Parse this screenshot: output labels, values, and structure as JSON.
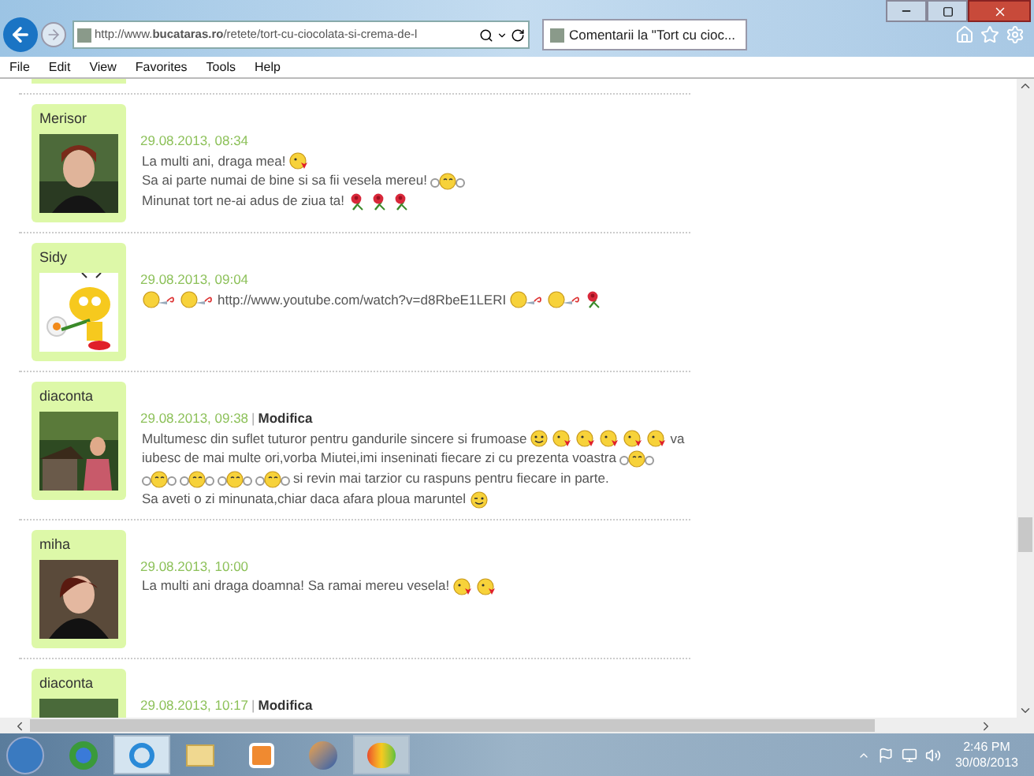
{
  "browser": {
    "address": "http://www.**bucataras.ro**/retete/tort-cu-ciocolata-si-crema-de-l",
    "tabs": [
      {
        "title": "Comentarii la \"Tort cu cioc...",
        "selected": true
      }
    ]
  },
  "menu": [
    "File",
    "Edit",
    "View",
    "Favorites",
    "Tools",
    "Help"
  ],
  "comments": [
    {
      "author": "Merisor",
      "date": "29.08.2013, 08:34",
      "lines": [
        [
          {
            "kind": "text",
            "text": "La multi ani, draga mea!"
          },
          {
            "kind": "kiss"
          }
        ],
        [
          {
            "kind": "text",
            "text": "Sa ai parte numai de bine si sa fii vesela mereu!"
          },
          {
            "kind": "hug"
          }
        ],
        [
          {
            "kind": "text",
            "text": "Minunat tort ne-ai adus de ziua ta!"
          },
          {
            "kind": "rose"
          },
          {
            "kind": "rose"
          },
          {
            "kind": "rose"
          }
        ]
      ]
    },
    {
      "author": "Sidy",
      "date": "29.08.2013, 09:04",
      "lines": [
        [
          {
            "kind": "party"
          },
          {
            "kind": "party"
          },
          {
            "kind": "text",
            "text": "http://www.youtube.com/watch?v=d8RbeE1LERI"
          },
          {
            "kind": "party"
          },
          {
            "kind": "party"
          },
          {
            "kind": "rose"
          }
        ]
      ]
    },
    {
      "author": "diaconta",
      "date": "29.08.2013, 09:38",
      "edit": {
        "separator": "|",
        "label": "Modifica"
      },
      "lines": [
        [
          {
            "kind": "text",
            "text": "Multumesc din suflet tuturor pentru gandurile sincere si frumoase"
          },
          {
            "kind": "smile"
          },
          {
            "kind": "kiss"
          },
          {
            "kind": "kiss"
          },
          {
            "kind": "kiss"
          },
          {
            "kind": "kiss"
          },
          {
            "kind": "kiss"
          },
          {
            "kind": "text",
            "text": "va"
          }
        ],
        [
          {
            "kind": "text",
            "text": "iubesc de mai multe ori,vorba Miutei,imi inseninati fiecare zi cu prezenta voastra"
          },
          {
            "kind": "hug"
          }
        ],
        [
          {
            "kind": "hug"
          },
          {
            "kind": "hug"
          },
          {
            "kind": "hug"
          },
          {
            "kind": "hug"
          },
          {
            "kind": "text",
            "text": "si revin mai tarzior cu raspuns pentru fiecare in parte."
          }
        ],
        [
          {
            "kind": "text",
            "text": "Sa aveti o zi minunata,chiar daca afara ploua maruntel"
          },
          {
            "kind": "wink"
          }
        ]
      ]
    },
    {
      "author": "miha",
      "date": "29.08.2013, 10:00",
      "lines": [
        [
          {
            "kind": "text",
            "text": "La multi ani draga doamna! Sa ramai mereu vesela!"
          },
          {
            "kind": "kiss"
          },
          {
            "kind": "kiss"
          }
        ]
      ]
    },
    {
      "author": "diaconta",
      "date": "29.08.2013, 10:17",
      "edit": {
        "separator": "|",
        "label": "Modifica"
      }
    }
  ],
  "taskbar": {
    "time": "2:46 PM",
    "date": "30/08/2013"
  }
}
